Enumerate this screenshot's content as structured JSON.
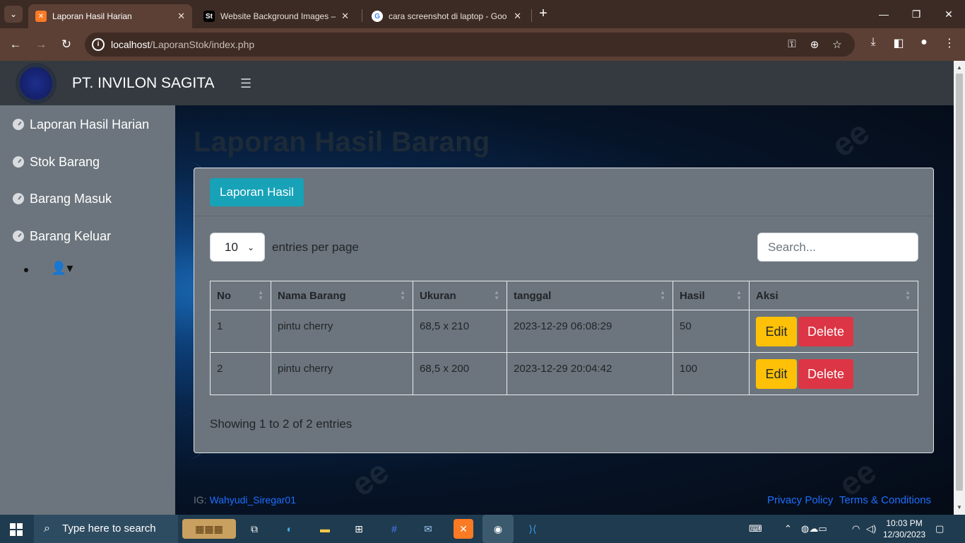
{
  "browser": {
    "tabs": [
      {
        "title": "Laporan Hasil Harian",
        "favicon": "xampp-icon",
        "active": true
      },
      {
        "title": "Website Background Images – F",
        "favicon": "st-icon",
        "active": false
      },
      {
        "title": "cara screenshot di laptop - Goo",
        "favicon": "google-icon",
        "active": false
      }
    ],
    "url_host": "localhost",
    "url_path": "/LaporanStok/index.php"
  },
  "app": {
    "brand": "PT. INVILON SAGITA",
    "sidebar": [
      {
        "label": "Laporan Hasil Harian",
        "icon": "tachometer-icon"
      },
      {
        "label": "Stok Barang",
        "icon": "tachometer-icon"
      },
      {
        "label": "Barang Masuk",
        "icon": "tachometer-icon"
      },
      {
        "label": "Barang Keluar",
        "icon": "tachometer-icon"
      }
    ],
    "page_title": "Laporan Hasil Barang",
    "report_button": "Laporan Hasil",
    "entries_value": "10",
    "entries_label": "entries per page",
    "search_placeholder": "Search...",
    "table": {
      "headers": [
        "No",
        "Nama Barang",
        "Ukuran",
        "tanggal",
        "Hasil",
        "Aksi"
      ],
      "rows": [
        {
          "no": "1",
          "nama": "pintu cherry",
          "ukuran": "68,5 x 210",
          "tanggal": "2023-12-29 06:08:29",
          "hasil": "50"
        },
        {
          "no": "2",
          "nama": "pintu cherry",
          "ukuran": "68,5 x 200",
          "tanggal": "2023-12-29 20:04:42",
          "hasil": "100"
        }
      ],
      "edit_label": "Edit",
      "delete_label": "Delete"
    },
    "showing": "Showing 1 to 2 of 2 entries",
    "footer": {
      "ig_prefix": "IG:",
      "ig_handle": "Wahyudi_Siregar01",
      "privacy": "Privacy Policy",
      "terms": "Terms & Conditions"
    },
    "watermark": "ee"
  },
  "taskbar": {
    "search_placeholder": "Type here to search",
    "time": "10:03 PM",
    "date": "12/30/2023"
  },
  "colors": {
    "navbar": "#343a40",
    "sidebar": "#6c757d",
    "info": "#17a2b8",
    "warning": "#ffc107",
    "danger": "#dc3545",
    "link": "#1e6fff"
  }
}
